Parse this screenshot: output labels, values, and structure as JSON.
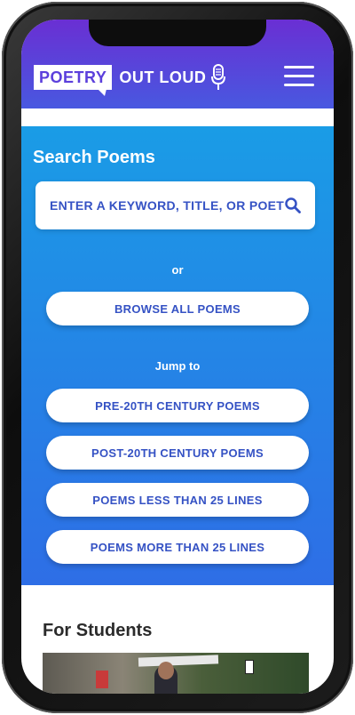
{
  "header": {
    "logo_part1": "POETRY",
    "logo_part2": "OUT LOUD"
  },
  "search": {
    "title": "Search Poems",
    "placeholder": "ENTER A KEYWORD, TITLE, OR POET",
    "or_label": "or",
    "browse_label": "BROWSE ALL POEMS",
    "jump_label": "Jump to",
    "jump_buttons": [
      "PRE-20TH CENTURY POEMS",
      "POST-20TH CENTURY POEMS",
      "POEMS LESS THAN 25 LINES",
      "POEMS MORE THAN 25 LINES"
    ]
  },
  "students": {
    "title": "For Students"
  },
  "colors": {
    "header_top": "#6a2fd3",
    "header_bottom": "#4858e0",
    "search_top": "#1a9ce6",
    "search_bottom": "#2e6ee6",
    "button_text": "#3552c4"
  },
  "icons": [
    "mic-icon",
    "hamburger-menu-icon",
    "search-icon"
  ]
}
